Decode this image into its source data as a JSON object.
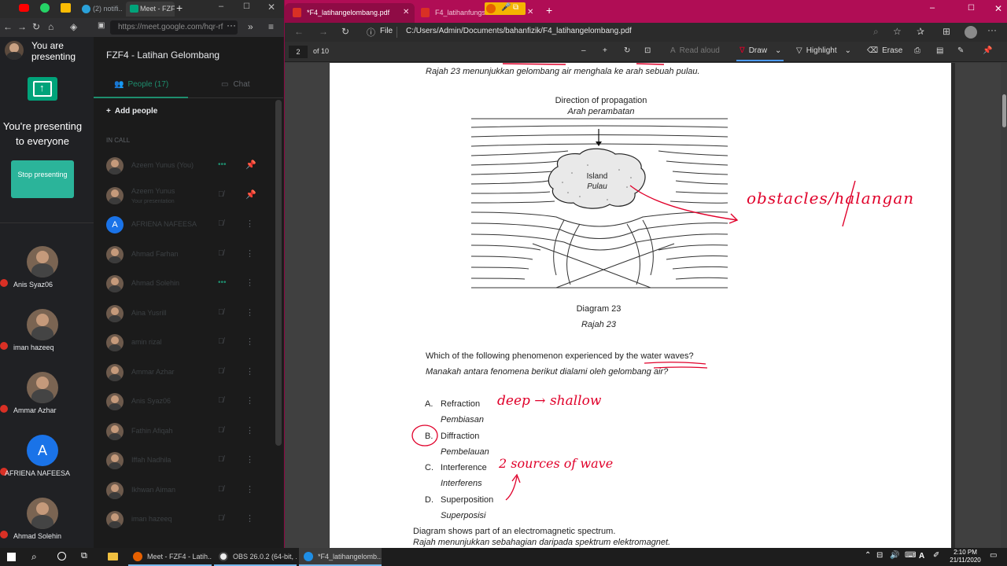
{
  "meet": {
    "tabs": [
      {
        "label": "(2) notifi..."
      },
      {
        "label": "Meet - FZF4"
      }
    ],
    "address_url": "https://meet.google.com/hqr-rf",
    "presenting_status": "You are presenting",
    "presenting_everyone": "You're presenting to everyone",
    "stop_presenting_label": "Stop presenting",
    "meeting_title": "FZF4 - Latihan Gelombang",
    "tab_people": "People (17)",
    "tab_chat": "Chat",
    "add_people": "Add people",
    "in_call": "IN CALL",
    "participants": [
      {
        "name": "Azeem Yunus (You)",
        "sub": "",
        "mic": "dots",
        "avatar": "photo"
      },
      {
        "name": "Azeem Yunus",
        "sub": "Your presentation",
        "mic": "muted",
        "avatar": "photo"
      },
      {
        "name": "AFRIENA NAFEESA",
        "sub": "",
        "mic": "muted",
        "avatar": "A"
      },
      {
        "name": "Ahmad Farhan",
        "sub": "",
        "mic": "muted",
        "avatar": "photo"
      },
      {
        "name": "Ahmad Solehin",
        "sub": "",
        "mic": "dots",
        "avatar": "photo"
      },
      {
        "name": "Aina Yusrill",
        "sub": "",
        "mic": "muted",
        "avatar": "photo"
      },
      {
        "name": "amin rizal",
        "sub": "",
        "mic": "muted",
        "avatar": "photo"
      },
      {
        "name": "Ammar Azhar",
        "sub": "",
        "mic": "muted",
        "avatar": "photo"
      },
      {
        "name": "Anis Syaz06",
        "sub": "",
        "mic": "muted",
        "avatar": "photo"
      },
      {
        "name": "Fathin Afiqah",
        "sub": "",
        "mic": "muted",
        "avatar": "photo"
      },
      {
        "name": "Iffah Nadhila",
        "sub": "",
        "mic": "muted",
        "avatar": "photo"
      },
      {
        "name": "Ikhwan Aiman",
        "sub": "",
        "mic": "muted",
        "avatar": "photo"
      },
      {
        "name": "iman hazeeq",
        "sub": "",
        "mic": "muted",
        "avatar": "photo"
      }
    ],
    "tiles": [
      {
        "name": "Anis Syaz06",
        "avatar": "photo"
      },
      {
        "name": "iman hazeeq",
        "avatar": "photo"
      },
      {
        "name": "Ammar Azhar",
        "avatar": "photo"
      },
      {
        "name": "AFRIENA NAFEESA",
        "avatar": "A"
      },
      {
        "name": "Ahmad Solehin",
        "avatar": "photo"
      }
    ]
  },
  "edge": {
    "tabs": [
      {
        "label": "*F4_latihangelombang.pdf"
      },
      {
        "label": "F4_latihanfungsike"
      }
    ],
    "file_label": "File",
    "path": "C:/Users/Admin/Documents/bahanfizik/F4_latihangelombang.pdf",
    "page_number": "2",
    "page_of": "of 10",
    "read_aloud": "Read aloud",
    "draw": "Draw",
    "highlight": "Highlight",
    "erase": "Erase"
  },
  "pdf": {
    "intro": "Rajah 23 menunjukkan gelombang air menghala ke arah sebuah pulau.",
    "direction_en": "Direction of propagation",
    "direction_ms": "Arah perambatan",
    "island_en": "Island",
    "island_ms": "Pulau",
    "diagram_en": "Diagram 23",
    "diagram_ms": "Rajah 23",
    "question_en": "Which of the following phenomenon experienced by the water waves?",
    "question_ms": "Manakah antara fenomena berikut dialami oleh gelombang air?",
    "options": [
      {
        "letter": "A.",
        "en": "Refraction",
        "ms": "Pembiasan"
      },
      {
        "letter": "B.",
        "en": "Diffraction",
        "ms": "Pembelauan"
      },
      {
        "letter": "C.",
        "en": "Interference",
        "ms": "Interferens"
      },
      {
        "letter": "D.",
        "en": "Superposition",
        "ms": "Superposisi"
      }
    ],
    "next_en": "Diagram shows part of an electromagnetic spectrum.",
    "next_ms": "Rajah menunjukkan sebahagian daripada spektrum elektromagnet.",
    "ink_obstacles": "obstacles/halangan",
    "ink_deep": "deep → shallow",
    "ink_sources": "2 sources of wave",
    "ink_color": "#e0002a"
  },
  "taskbar": {
    "items": [
      {
        "label": "Meet - FZF4 - Latih..."
      },
      {
        "label": "OBS 26.0.2 (64-bit, ..."
      },
      {
        "label": "*F4_latihangelomb..."
      }
    ],
    "time": "2:10 PM",
    "date": "21/11/2020",
    "lang": "A"
  }
}
